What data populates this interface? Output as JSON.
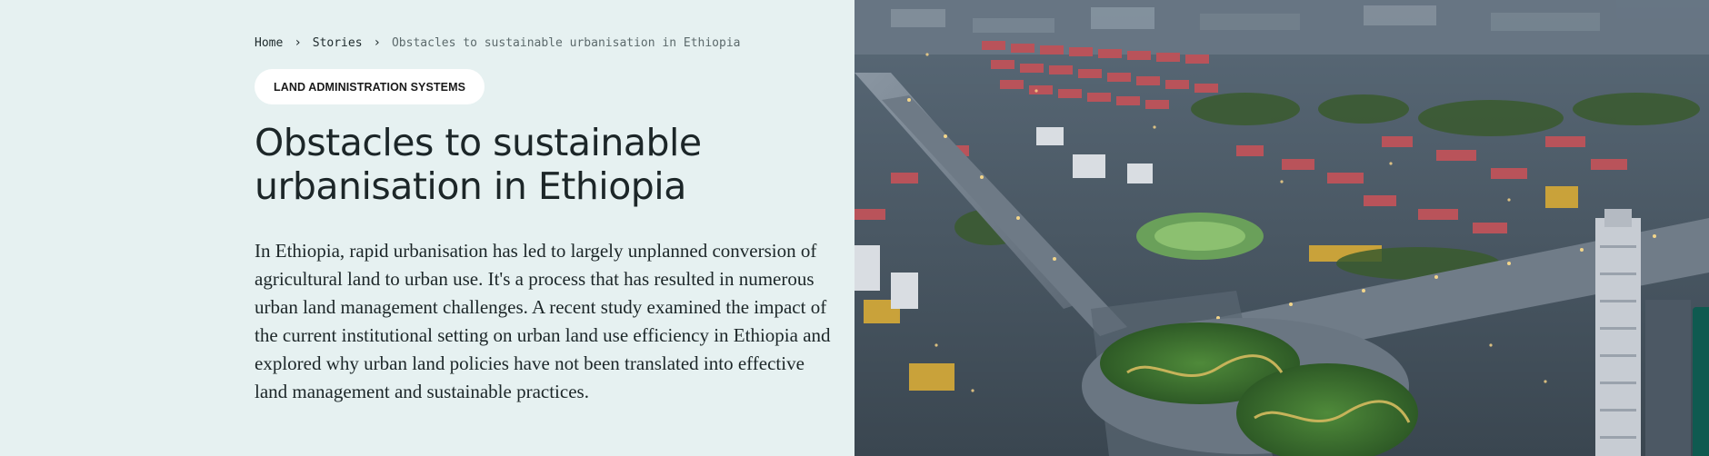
{
  "breadcrumb": {
    "home": "Home",
    "stories": "Stories",
    "current": "Obstacles to sustainable urbanisation in Ethiopia"
  },
  "tag": "LAND ADMINISTRATION SYSTEMS",
  "title": "Obstacles to sustainable urbanisation in Ethiopia",
  "lead": "In Ethiopia, rapid urbanisation has led to largely unplanned conversion of agricultural land to urban use. It's a process that has resulted in numerous urban land management challenges. A recent study examined the impact of the current institutional setting on urban land use efficiency in Ethiopia and explored why urban land policies have not been translated into effective land management and sustainable practices.",
  "colors": {
    "panel_background": "#e6f1f1",
    "text_dark": "#1c2628",
    "breadcrumb_current": "#5c6a6c",
    "tag_background": "#ffffff",
    "feedback_tab": "#0f5a50"
  }
}
